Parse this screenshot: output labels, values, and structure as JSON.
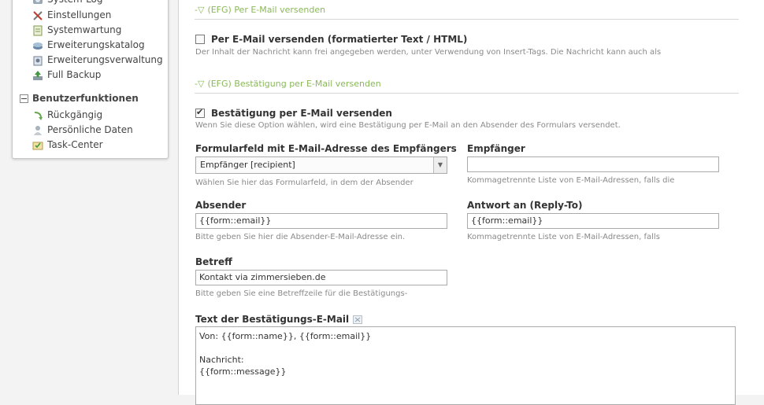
{
  "sidebar": {
    "items_top": [
      {
        "label": "System-Log",
        "icon": "system-log-icon"
      },
      {
        "label": "Einstellungen",
        "icon": "tools-icon"
      },
      {
        "label": "Systemwartung",
        "icon": "maintenance-icon"
      },
      {
        "label": "Erweiterungskatalog",
        "icon": "catalog-icon"
      },
      {
        "label": "Erweiterungsverwaltung",
        "icon": "extension-manager-icon"
      },
      {
        "label": "Full Backup",
        "icon": "backup-icon"
      }
    ],
    "group_title": "Benutzerfunktionen",
    "items_user": [
      {
        "label": "Rückgängig",
        "icon": "undo-icon"
      },
      {
        "label": "Persönliche Daten",
        "icon": "personal-data-icon"
      },
      {
        "label": "Task-Center",
        "icon": "task-center-icon"
      }
    ]
  },
  "section1": {
    "legend": "(EFG) Per E-Mail versenden",
    "checkbox_label": "Per E-Mail versenden (formatierter Text / HTML)",
    "checked": false,
    "help": "Der Inhalt der Nachricht kann frei angegeben werden, unter Verwendung von Insert-Tags. Die Nachricht kann auch als"
  },
  "section2": {
    "legend": "(EFG) Bestätigung per E-Mail versenden",
    "checkbox_label": "Bestätigung per E-Mail versenden",
    "checked": true,
    "help": "Wenn Sie diese Option wählen, wird eine Bestätigung per E-Mail an den Absender des Formulars versendet.",
    "recipient_field": {
      "label": "Formularfeld mit E-Mail-Adresse des Empfängers",
      "value": "Empfänger [recipient]",
      "help": "Wählen Sie hier das Formularfeld, in dem der Absender"
    },
    "recipient": {
      "label": "Empfänger",
      "value": "",
      "help": "Kommagetrennte Liste von E-Mail-Adressen, falls die"
    },
    "sender": {
      "label": "Absender",
      "value": "{{form::email}}",
      "help": "Bitte geben Sie hier die Absender-E-Mail-Adresse ein."
    },
    "reply_to": {
      "label": "Antwort an (Reply-To)",
      "value": "{{form::email}}",
      "help": "Kommagetrennte Liste von E-Mail-Adressen, falls"
    },
    "subject": {
      "label": "Betreff",
      "value": "Kontakt via zimmersieben.de",
      "help": "Bitte geben Sie eine Betreffzeile für die Bestätigungs-"
    },
    "body": {
      "label": "Text der Bestätigungs-E-Mail",
      "lines": [
        "Von: {{form::name}}, {{form::email}}",
        "",
        "Nachricht:",
        "{{form::message}}"
      ]
    }
  },
  "colors": {
    "legend_green": "#8ab858",
    "help_gray": "#8a8a8a"
  }
}
